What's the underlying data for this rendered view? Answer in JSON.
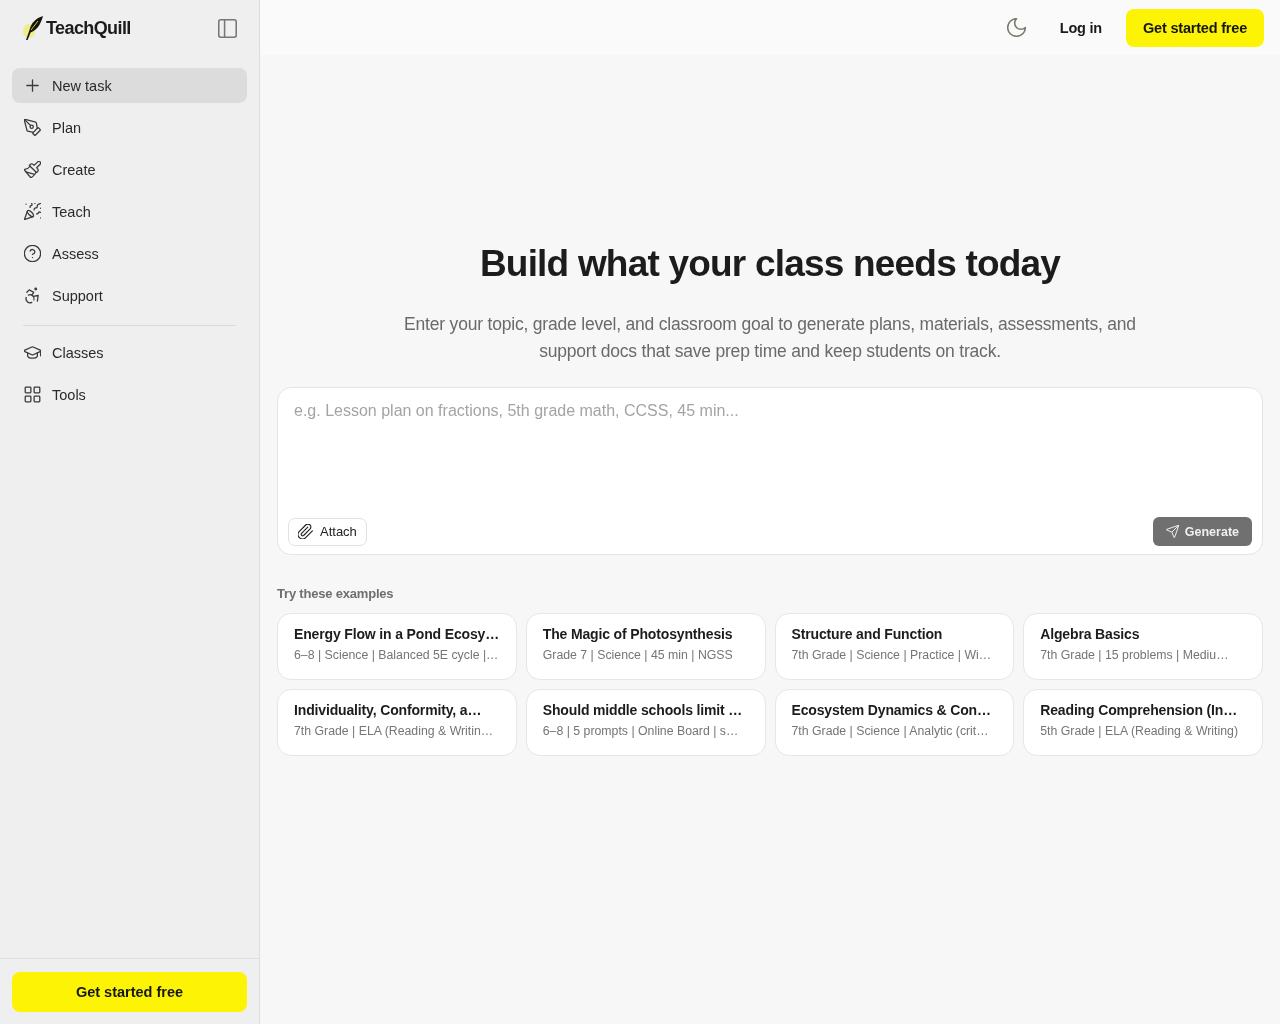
{
  "sidebar": {
    "logo": "TeachQuill",
    "nav_items": [
      {
        "label": "New task",
        "selected": true
      },
      {
        "label": "Plan",
        "selected": false
      },
      {
        "label": "Create",
        "selected": false
      },
      {
        "label": "Teach",
        "selected": false
      },
      {
        "label": "Assess",
        "selected": false
      },
      {
        "label": "Support",
        "selected": false
      }
    ],
    "library_items": [
      {
        "label": "Classes",
        "selected": false
      },
      {
        "label": "Tools",
        "selected": false
      }
    ],
    "cta": "Get started free"
  },
  "header": {
    "login": "Log in",
    "cta": "Get started free"
  },
  "hero": {
    "title": "Build what your class needs today",
    "subtitle": "Enter your topic, grade level, and classroom goal to generate plans, materials, assessments, and support docs that save prep time and keep students on track."
  },
  "prompt": {
    "placeholder": "e.g. Lesson plan on fractions, 5th grade math, CCSS, 45 min...",
    "attach": "Attach",
    "generate": {
      "label": "Generate",
      "disabled": true
    }
  },
  "examples": {
    "heading": "Try these examples",
    "cards": [
      {
        "title": "Energy Flow in a Pond Ecosy…",
        "meta": "6–8 | Science | Balanced 5E cycle |…"
      },
      {
        "title": "The Magic of Photosynthesis",
        "meta": "Grade 7 | Science | 45 min | NGSS"
      },
      {
        "title": "Structure and Function",
        "meta": "7th Grade | Science | Practice | Wi…"
      },
      {
        "title": "Algebra Basics",
        "meta": "7th Grade | 15 problems | Mediu…"
      },
      {
        "title": "Individuality, Conformity, a…",
        "meta": "7th Grade | ELA (Reading & Writin…"
      },
      {
        "title": "Should middle schools limit …",
        "meta": "6–8 | 5 prompts | Online Board | s…"
      },
      {
        "title": "Ecosystem Dynamics & Con…",
        "meta": "7th Grade | Science | Analytic (crit…"
      },
      {
        "title": "Reading Comprehension (In…",
        "meta": "5th Grade | ELA (Reading & Writing)"
      }
    ]
  }
}
